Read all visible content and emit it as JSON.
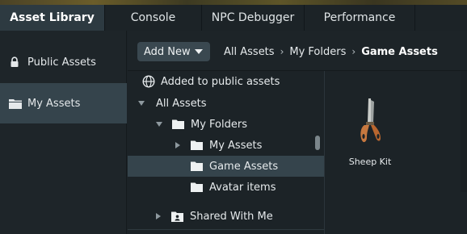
{
  "tabs": [
    {
      "label": "Asset Library",
      "active": true
    },
    {
      "label": "Console",
      "active": false
    },
    {
      "label": "NPC Debugger",
      "active": false
    },
    {
      "label": "Performance",
      "active": false
    }
  ],
  "sidebar": {
    "items": [
      {
        "label": "Public Assets",
        "icon": "lock-icon",
        "selected": false
      },
      {
        "label": "My Assets",
        "icon": "folder-icon",
        "selected": true
      }
    ]
  },
  "toolbar": {
    "add_new_label": "Add New",
    "breadcrumb": [
      "All Assets",
      "My Folders",
      "Game Assets"
    ]
  },
  "tree": {
    "public_notice": "Added to public assets",
    "rows": [
      {
        "label": "All Assets",
        "expanded": true
      },
      {
        "label": "My Folders",
        "expanded": true
      },
      {
        "label": "My Assets",
        "expanded": false
      },
      {
        "label": "Game Assets",
        "selected": true
      },
      {
        "label": "Avatar items"
      },
      {
        "label": "Shared With Me",
        "expanded": false
      }
    ]
  },
  "content": {
    "assets": [
      {
        "name": "Sheep Kit",
        "icon": "shears-icon"
      }
    ]
  },
  "colors": {
    "selected_bg": "#35444c",
    "active_tab_bg": "#2d3a41",
    "panel_bg": "#1c2327"
  }
}
